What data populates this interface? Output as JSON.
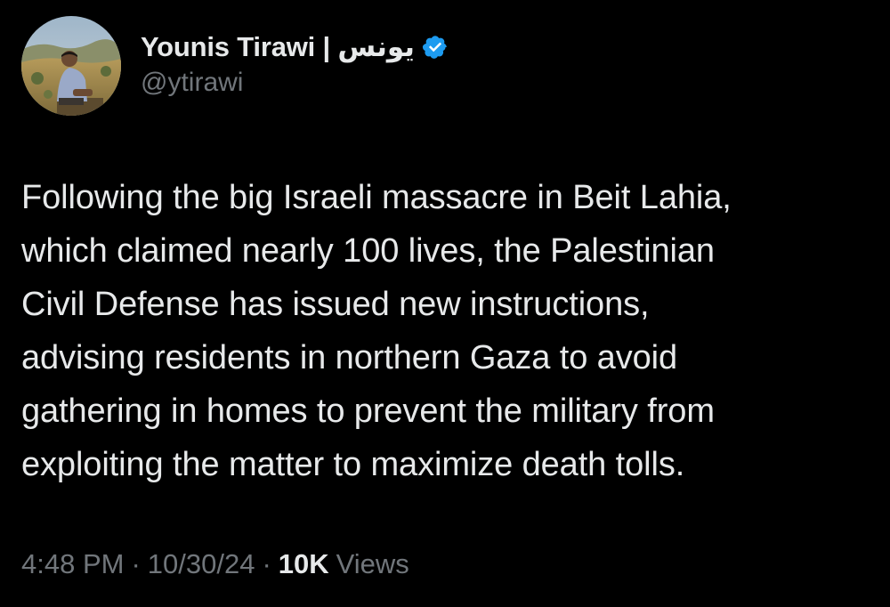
{
  "author": {
    "display_name": "Younis Tirawi | يونس",
    "handle": "@ytirawi",
    "verified": true,
    "verified_icon": "verified-badge-icon",
    "verified_color": "#1d9bf0"
  },
  "tweet": {
    "text": "Following the big Israeli massacre in Beit Lahia,\nwhich claimed nearly 100 lives, the Palestinian\nCivil Defense has issued new instructions,\nadvising residents in northern Gaza to avoid\ngathering in homes to prevent the military from\nexploiting the matter to maximize death tolls."
  },
  "meta": {
    "time": "4:48 PM",
    "separator": "·",
    "date": "10/30/24",
    "views_count": "10K",
    "views_label": "Views"
  },
  "colors": {
    "background": "#000000",
    "primary_text": "#e7e9ea",
    "secondary_text": "#71767b"
  }
}
